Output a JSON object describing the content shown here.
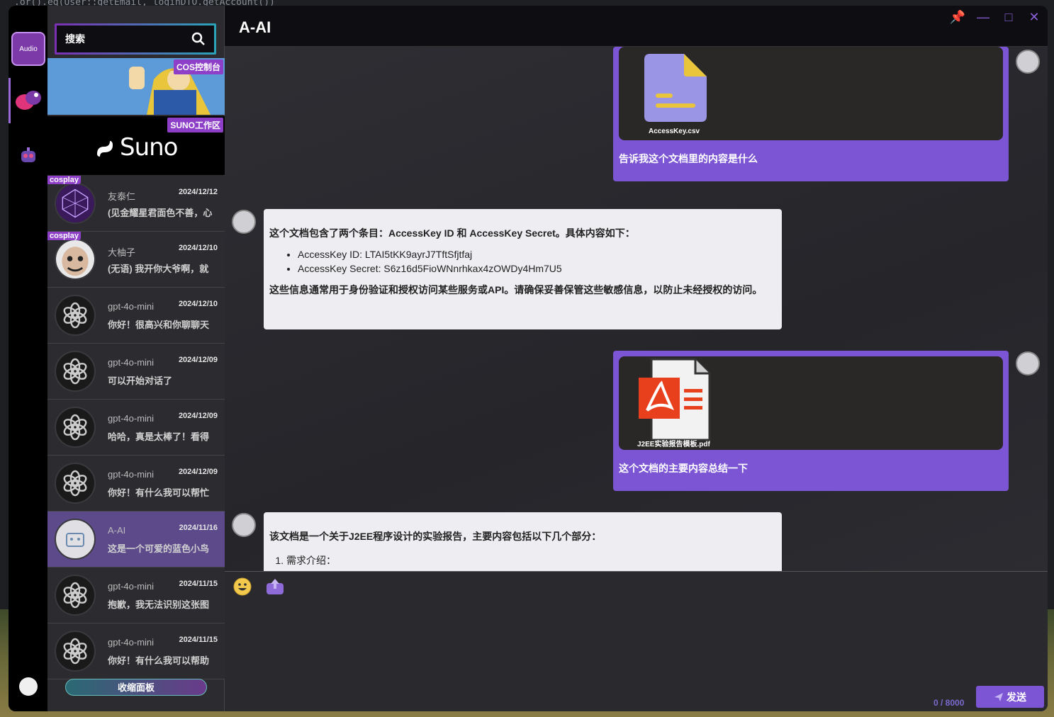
{
  "background": {
    "code_snippet": ".or().eq(User::getEmail, loginDTO.getAccount())"
  },
  "rail": {
    "audio_label": "Audio"
  },
  "sidebar": {
    "search_placeholder": "搜索",
    "banners": [
      {
        "tag": "COS控制台"
      },
      {
        "tag": "SUNO工作区",
        "logo_text": "Suno"
      }
    ],
    "chats": [
      {
        "tag": "cosplay",
        "name": "友泰仁",
        "date": "2024/12/12",
        "message": "(见金耀星君面色不善，心"
      },
      {
        "tag": "cosplay",
        "name": "大柚子",
        "date": "2024/12/10",
        "message": "(无语) 我开你大爷啊，就"
      },
      {
        "tag": "",
        "name": "gpt-4o-mini",
        "date": "2024/12/10",
        "message": "你好！很高兴和你聊聊天"
      },
      {
        "tag": "",
        "name": "gpt-4o-mini",
        "date": "2024/12/09",
        "message": "可以开始对话了"
      },
      {
        "tag": "",
        "name": "gpt-4o-mini",
        "date": "2024/12/09",
        "message": "哈哈，真是太棒了！看得"
      },
      {
        "tag": "",
        "name": "gpt-4o-mini",
        "date": "2024/12/09",
        "message": "你好！有什么我可以帮忙"
      },
      {
        "tag": "",
        "name": "A-AI",
        "date": "2024/11/16",
        "message": "这是一个可爱的蓝色小鸟"
      },
      {
        "tag": "",
        "name": "gpt-4o-mini",
        "date": "2024/11/15",
        "message": "抱歉，我无法识别这张图"
      },
      {
        "tag": "",
        "name": "gpt-4o-mini",
        "date": "2024/11/15",
        "message": "你好！有什么我可以帮助"
      }
    ],
    "collapse_label": "收缩面板"
  },
  "header": {
    "title": "A-AI"
  },
  "messages": {
    "m1": {
      "file_name": "AccessKey.csv",
      "text": "告诉我这个文档里的内容是什么"
    },
    "m2": {
      "intro": "这个文档包含了两个条目：AccessKey ID 和 AccessKey Secret。具体内容如下：",
      "items": [
        "AccessKey ID: LTAI5tKK9ayrJ7TftSfjtfaj",
        "AccessKey Secret: S6z16d5FioWNnrhkax4zOWDy4Hm7U5"
      ],
      "outro": "这些信息通常用于身份验证和授权访问某些服务或API。请确保妥善保管这些敏感信息，以防止未经授权的访问。"
    },
    "m3": {
      "file_name": "J2EE实验报告模板.pdf",
      "text": "这个文档的主要内容总结一下"
    },
    "m4": {
      "intro": "该文档是一个关于J2EE程序设计的实验报告，主要内容包括以下几个部分：",
      "first_item": "需求介绍："
    }
  },
  "composer": {
    "counter": "0 / 8000",
    "send_label": "发送"
  },
  "colors": {
    "accent": "#7b55d4",
    "active_chat": "#5c4a8a"
  }
}
